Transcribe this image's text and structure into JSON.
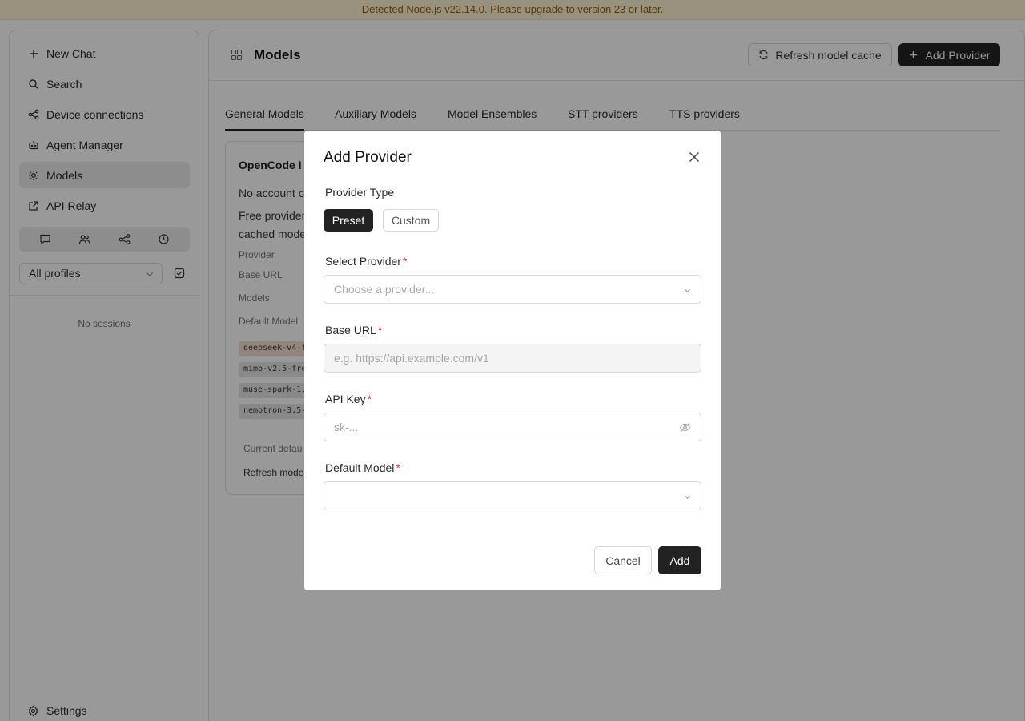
{
  "banner": {
    "text": "Detected Node.js v22.14.0. Please upgrade to version 23 or later."
  },
  "sidebar": {
    "items": [
      {
        "label": "New Chat",
        "icon": "plus-icon"
      },
      {
        "label": "Search",
        "icon": "search-icon"
      },
      {
        "label": "Device connections",
        "icon": "share-icon"
      },
      {
        "label": "Agent Manager",
        "icon": "bot-icon"
      },
      {
        "label": "Models",
        "icon": "sun-icon",
        "active": true
      },
      {
        "label": "API Relay",
        "icon": "external-link-icon"
      }
    ],
    "quick_icons": [
      "chat-icon",
      "users-icon",
      "workflow-icon",
      "clock-icon"
    ],
    "profile_select": "All profiles",
    "empty_text": "No sessions",
    "settings_label": "Settings"
  },
  "header": {
    "title": "Models",
    "refresh_label": "Refresh model cache",
    "add_provider_label": "Add Provider"
  },
  "tabs": [
    {
      "label": "General Models",
      "active": true
    },
    {
      "label": "Auxiliary Models"
    },
    {
      "label": "Model Ensembles"
    },
    {
      "label": "STT providers"
    },
    {
      "label": "TTS providers"
    }
  ],
  "card": {
    "title": "OpenCode I",
    "line1": "No account c",
    "line2a": "Free provider",
    "line2b": "cached mode",
    "labels": [
      "Provider",
      "Base URL",
      "Models",
      "Default Model"
    ],
    "chips": [
      "deepseek-v4-f",
      "mimo-v2.5-fre",
      "muse-spark-1.",
      "nemotron-3.5-"
    ],
    "current_default": "Current defau",
    "refresh_text": "Refresh mode"
  },
  "dialog": {
    "title": "Add Provider",
    "provider_type_label": "Provider Type",
    "type_preset": "Preset",
    "type_custom": "Custom",
    "select_provider_label": "Select Provider",
    "select_provider_placeholder": "Choose a provider...",
    "base_url_label": "Base URL",
    "base_url_placeholder": "e.g. https://api.example.com/v1",
    "api_key_label": "API Key",
    "api_key_placeholder": "sk-...",
    "default_model_label": "Default Model",
    "default_model_value": "",
    "required_mark": "*",
    "cancel_label": "Cancel",
    "add_label": "Add"
  },
  "colors": {
    "accent": "#222222",
    "banner_bg": "#fbf4d2",
    "banner_text": "#9a5b12",
    "required": "#dd3333"
  }
}
